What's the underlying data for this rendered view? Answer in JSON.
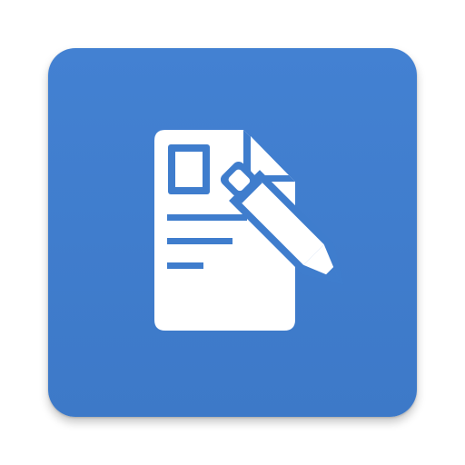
{
  "app_icon": {
    "icon": "document-edit-icon",
    "background_color": "#3f7dcd",
    "glyph_color": "#ffffff"
  }
}
